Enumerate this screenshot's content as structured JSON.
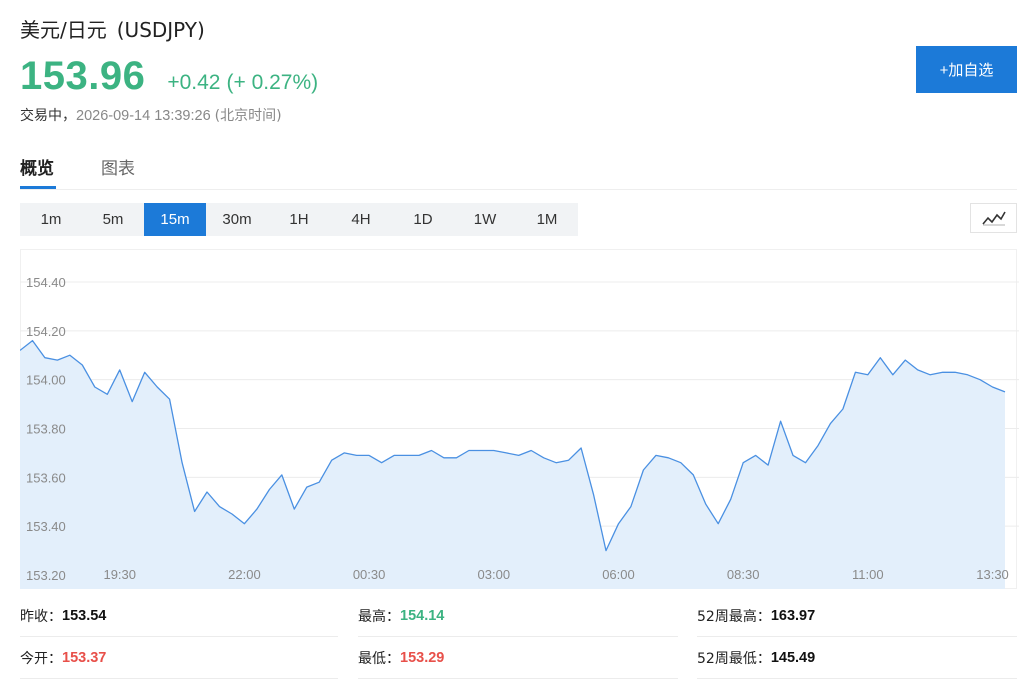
{
  "header": {
    "pair_name": "美元/日元",
    "pair_code": "(USDJPY)",
    "price": "153.96",
    "change": "+0.42",
    "change_pct": "(+ 0.27%)",
    "status_label": "交易中，",
    "timestamp": "2026-09-14 13:39:26",
    "timezone": "(北京时间)",
    "add_watchlist_label": "+加自选"
  },
  "tabs": [
    {
      "label": "概览",
      "active": true
    },
    {
      "label": "图表",
      "active": false
    }
  ],
  "intervals": [
    "1m",
    "5m",
    "15m",
    "30m",
    "1H",
    "4H",
    "1D",
    "1W",
    "1M"
  ],
  "active_interval": "15m",
  "colors": {
    "up": "#3cb382",
    "down": "#e8504a",
    "accent": "#1c7ad8",
    "line": "#4a90e2",
    "area": "#e3effb"
  },
  "chart_data": {
    "type": "area",
    "ylim": [
      153.2,
      154.5
    ],
    "y_ticks": [
      153.2,
      153.4,
      153.6,
      153.8,
      154.0,
      154.2,
      154.4
    ],
    "y_tick_labels": [
      "153.20",
      "153.40",
      "153.60",
      "153.80",
      "154.00",
      "154.20",
      "154.40"
    ],
    "x_ticks": [
      {
        "label": "19:30",
        "idx": 8
      },
      {
        "label": "22:00",
        "idx": 18
      },
      {
        "label": "00:30",
        "idx": 28
      },
      {
        "label": "03:00",
        "idx": 38
      },
      {
        "label": "06:00",
        "idx": 48
      },
      {
        "label": "08:30",
        "idx": 58
      },
      {
        "label": "11:00",
        "idx": 68
      },
      {
        "label": "13:30",
        "idx": 78
      }
    ],
    "values": [
      154.12,
      154.16,
      154.09,
      154.08,
      154.1,
      154.06,
      153.97,
      153.94,
      154.04,
      153.91,
      154.03,
      153.97,
      153.92,
      153.66,
      153.46,
      153.54,
      153.48,
      153.45,
      153.41,
      153.47,
      153.55,
      153.61,
      153.47,
      153.56,
      153.58,
      153.67,
      153.7,
      153.69,
      153.69,
      153.66,
      153.69,
      153.69,
      153.69,
      153.71,
      153.68,
      153.68,
      153.71,
      153.71,
      153.71,
      153.7,
      153.69,
      153.71,
      153.68,
      153.66,
      153.67,
      153.72,
      153.53,
      153.3,
      153.41,
      153.48,
      153.63,
      153.69,
      153.68,
      153.66,
      153.61,
      153.49,
      153.41,
      153.51,
      153.66,
      153.69,
      153.65,
      153.83,
      153.69,
      153.66,
      153.73,
      153.82,
      153.88,
      154.03,
      154.02,
      154.09,
      154.02,
      154.08,
      154.04,
      154.02,
      154.03,
      154.03,
      154.02,
      154.0,
      153.97,
      153.95
    ]
  },
  "stats": {
    "prev_close_label": "昨收：",
    "prev_close": "153.54",
    "high_label": "最高：",
    "high": "154.14",
    "high52_label": "52周最高：",
    "high52": "163.97",
    "open_label": "今开：",
    "open": "153.37",
    "low_label": "最低：",
    "low": "153.29",
    "low52_label": "52周最低：",
    "low52": "145.49"
  }
}
